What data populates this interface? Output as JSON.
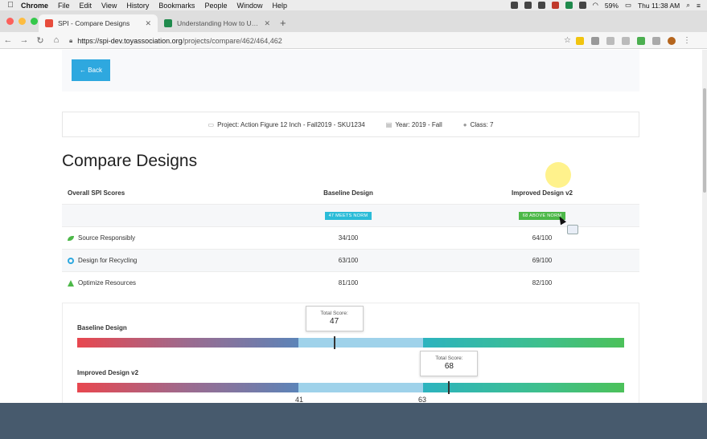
{
  "menubar": {
    "app": "Chrome",
    "items": [
      "File",
      "Edit",
      "View",
      "History",
      "Bookmarks",
      "People",
      "Window",
      "Help"
    ],
    "battery": "59%",
    "clock": "Thu 11:38 AM"
  },
  "browser": {
    "tabs": [
      {
        "label": "SPI - Compare Designs",
        "favicon_color": "#e74c3c"
      },
      {
        "label": "Understanding How to Use The...",
        "favicon_color": "#1f8a4c"
      }
    ],
    "url_host": "https://spi-dev.toyassociation.org",
    "url_path": "/projects/compare/462/464,462",
    "new_tab": "+"
  },
  "page": {
    "back_label": "← Back",
    "project_label": "Project: Action Figure 12 Inch - Fall2019 - SKU1234",
    "year_label": "Year: 2019 - Fall",
    "class_label": "Class: 7",
    "title": "Compare Designs",
    "table": {
      "col1": "Overall SPI Scores",
      "col2": "Baseline Design",
      "col3": "Improved Design v2",
      "badge_baseline": "47 MEETS NORM",
      "badge_improved": "68 ABOVE NORM",
      "rows": [
        {
          "label": "Source Responsibly",
          "baseline": "34/100",
          "improved": "64/100"
        },
        {
          "label": "Design for Recycling",
          "baseline": "63/100",
          "improved": "69/100"
        },
        {
          "label": "Optimize Resources",
          "baseline": "81/100",
          "improved": "82/100"
        }
      ]
    },
    "bars": {
      "baseline_label": "Baseline Design",
      "improved_label": "Improved Design v2",
      "tooltip_label": "Total Score:",
      "baseline_score": "47",
      "improved_score": "68",
      "tick_low": "41",
      "tick_high": "63",
      "scale_max": 100
    }
  },
  "colors": {
    "accent_blue": "#2ea8df",
    "meets_norm": "#2bbcd8",
    "above_norm": "#4cb848"
  }
}
